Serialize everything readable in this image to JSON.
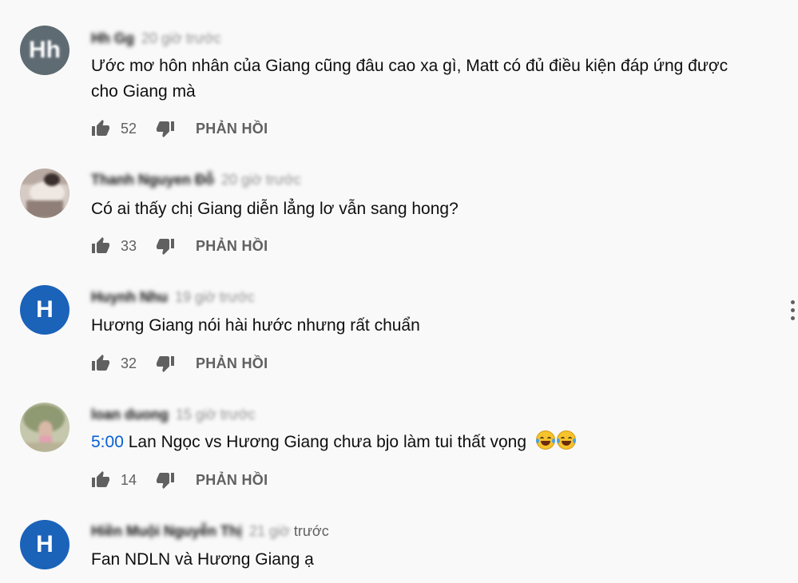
{
  "labels": {
    "reply": "PHẢN HỒI"
  },
  "comments": [
    {
      "author": "Hh Gg",
      "time": "20 giờ trước",
      "avatar_text": "Hh",
      "avatar_color": "#5f6b73",
      "text": "Ước mơ hôn nhân của Giang cũng đâu cao xa gì, Matt có đủ điều kiện đáp ứng được cho Giang mà",
      "likes": "52"
    },
    {
      "author": "Thanh Nguyen Đỗ",
      "time": "20 giờ trước",
      "avatar_text": "",
      "avatar_color": "#cbbcb3",
      "text": "Có ai thấy chị Giang diễn lẳng lơ vẫn sang hong?",
      "likes": "33"
    },
    {
      "author": "Huynh Nhu",
      "time": "19 giờ trước",
      "avatar_text": "H",
      "avatar_color": "#1b62b9",
      "text": "Hương Giang nói hài hước nhưng rất chuẩn",
      "likes": "32"
    },
    {
      "author": "loan duong",
      "time": "15 giờ trước",
      "avatar_text": "",
      "avatar_color": "#c9cbb2",
      "timestamp_link": "5:00",
      "text": " Lan Ngọc vs Hương Giang chưa bjo làm tui thất vọng",
      "emoji": "face-with-tears-of-joy",
      "likes": "14"
    },
    {
      "author": "Hiền Muội Nguyễn Thị",
      "time_num": "21 giờ",
      "time_word": "trước",
      "avatar_text": "H",
      "avatar_color": "#1b62b9",
      "text": "Fan NDLN và Hương Giang ạ"
    }
  ],
  "icons": {
    "like": "thumbs-up-icon",
    "dislike": "thumbs-down-icon",
    "more": "more-vertical-icon"
  }
}
